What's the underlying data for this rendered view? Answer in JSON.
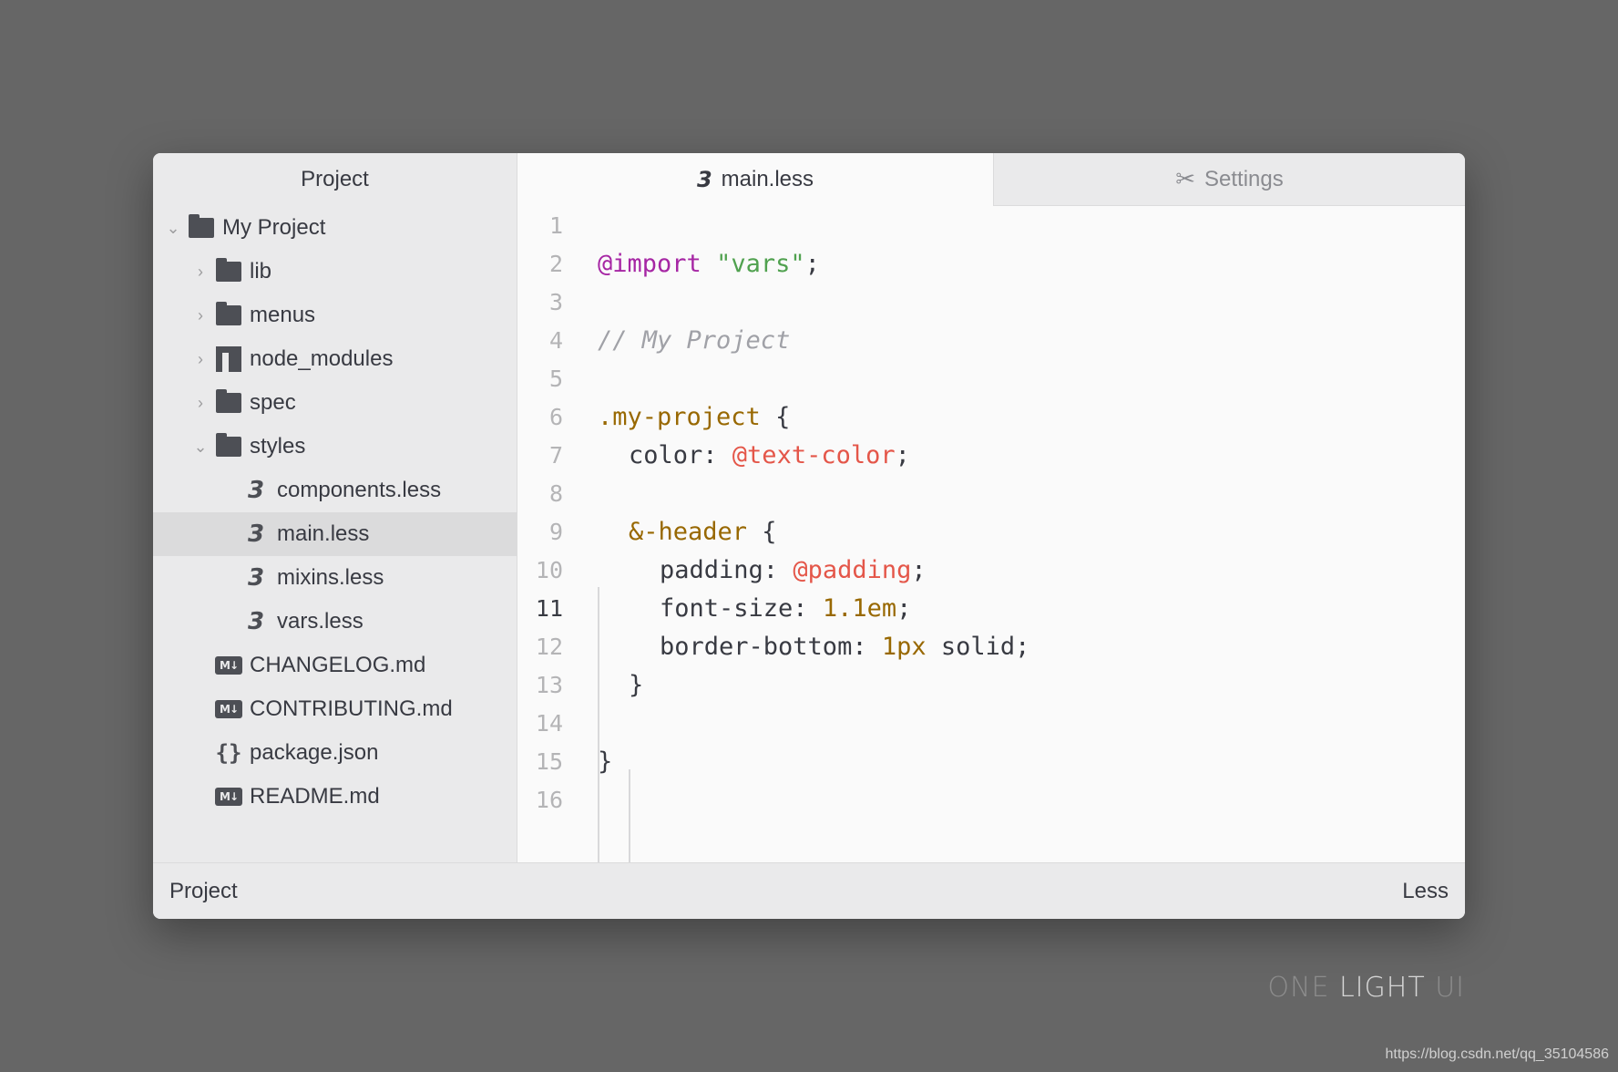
{
  "sidebar": {
    "title": "Project",
    "root": {
      "label": "My Project",
      "icon": "folder-icon",
      "expanded": true
    },
    "items": [
      {
        "label": "lib",
        "icon": "folder-icon",
        "chevron": "right"
      },
      {
        "label": "menus",
        "icon": "folder-icon",
        "chevron": "right"
      },
      {
        "label": "node_modules",
        "icon": "npm-icon",
        "chevron": "right"
      },
      {
        "label": "spec",
        "icon": "folder-icon",
        "chevron": "right"
      },
      {
        "label": "styles",
        "icon": "folder-icon",
        "chevron": "down"
      }
    ],
    "style_files": [
      {
        "label": "components.less",
        "icon": "css3-icon"
      },
      {
        "label": "main.less",
        "icon": "css3-icon",
        "selected": true
      },
      {
        "label": "mixins.less",
        "icon": "css3-icon"
      },
      {
        "label": "vars.less",
        "icon": "css3-icon"
      }
    ],
    "root_files": [
      {
        "label": "CHANGELOG.md",
        "icon": "markdown-icon"
      },
      {
        "label": "CONTRIBUTING.md",
        "icon": "markdown-icon"
      },
      {
        "label": "package.json",
        "icon": "json-braces-icon"
      },
      {
        "label": "README.md",
        "icon": "markdown-icon"
      }
    ]
  },
  "tabs": [
    {
      "label": "main.less",
      "icon": "css3-icon",
      "active": true
    },
    {
      "label": "Settings",
      "icon": "tools-icon",
      "active": false
    }
  ],
  "editor": {
    "current_line": "11",
    "line_numbers": [
      "1",
      "2",
      "3",
      "4",
      "5",
      "6",
      "7",
      "8",
      "9",
      "10",
      "11",
      "12",
      "13",
      "14",
      "15",
      "16"
    ],
    "code": {
      "l2_import": "@import",
      "l2_string": "\"vars\"",
      "l2_end": ";",
      "l4_comment": "// My Project",
      "l6_selector": ".my-project",
      "l6_brace": " {",
      "l7_prop": "color: ",
      "l7_var": "@text-color",
      "l7_end": ";",
      "l9_selector": "&-header",
      "l9_brace": " {",
      "l10_prop": "padding: ",
      "l10_var": "@padding",
      "l10_end": ";",
      "l11_prop": "font-size: ",
      "l11_num": "1.1em",
      "l11_end": ";",
      "l12_prop": "border-bottom: ",
      "l12_num": "1px",
      "l12_end": " solid;",
      "l13_brace": "}",
      "l15_brace": "}"
    }
  },
  "statusbar": {
    "left": "Project",
    "right": "Less"
  },
  "brand": {
    "part1": "ONE ",
    "part2": "LIGHT",
    "part3": " UI"
  },
  "watermark": "https://blog.csdn.net/qq_35104586",
  "colors": {
    "keyword": "#a626a4",
    "string": "#50a14f",
    "comment": "#a0a1a7",
    "selector": "#986801",
    "variable": "#e45649",
    "number": "#986801",
    "background": "#666666"
  }
}
